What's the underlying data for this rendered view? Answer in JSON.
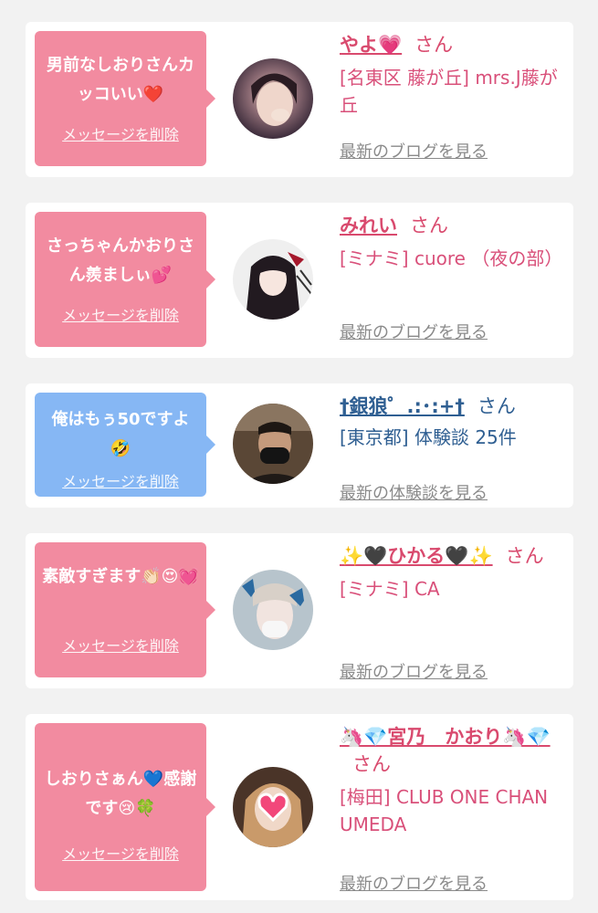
{
  "cards": [
    {
      "message": "男前なしおりさんカッコいい❤️",
      "delete_label": "メッセージを削除",
      "name": "やよ💗",
      "honorific": "さん",
      "meta": "[名東区 藤が丘] mrs.J藤が丘",
      "latest_link": "最新のブログを見る",
      "avatar_icon": "avatar-photo"
    },
    {
      "message": "さっちゃんかおりさん羨ましぃ💕",
      "delete_label": "メッセージを削除",
      "name": "みれい",
      "honorific": "さん",
      "meta": "[ミナミ] cuore （夜の部）",
      "latest_link": "最新のブログを見る",
      "avatar_icon": "avatar-anime"
    },
    {
      "message": "俺はもぅ50ですよ🤣",
      "delete_label": "メッセージを削除",
      "name": "†銀狼゜.:･:+†",
      "honorific": "さん",
      "meta": "[東京都] 体験談 25件",
      "latest_link": "最新の体験談を見る",
      "avatar_icon": "avatar-masked-man"
    },
    {
      "message": "素敵すぎます👏🏻😍💓",
      "delete_label": "メッセージを削除",
      "name": "✨🖤ひかる🖤✨",
      "honorific": "さん",
      "meta": "[ミナミ] CA",
      "latest_link": "最新のブログを見る",
      "avatar_icon": "avatar-butterflies"
    },
    {
      "message": "しおりさぁん💙感謝です😢🍀",
      "delete_label": "メッセージを削除",
      "name": "🦄💎宮乃　かおり🦄💎",
      "honorific": "さん",
      "meta": "[梅田] CLUB ONE CHAN UMEDA",
      "latest_link": "最新のブログを見る",
      "avatar_icon": "avatar-heart-sticker"
    }
  ],
  "colors": {
    "pink_bubble": "#f28ba0",
    "blue_bubble": "#86b7f4",
    "pink_text": "#d94a6e",
    "blue_text": "#2f5f92",
    "background": "#f2f2f2"
  }
}
